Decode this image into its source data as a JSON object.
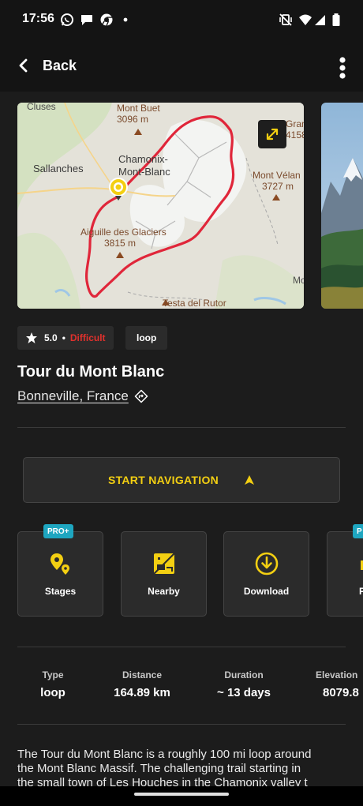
{
  "status_bar": {
    "time": "17:56",
    "left_icons": [
      "whatsapp-icon",
      "chat-bubble-icon",
      "chrome-icon",
      "notification-dot-icon"
    ],
    "right_icons": [
      "vibrate-off-icon",
      "wifi-icon",
      "signal-icon",
      "battery-icon"
    ]
  },
  "app_bar": {
    "back_label": "Back",
    "menu_icon": "more-vertical-icon"
  },
  "gallery": {
    "map_labels": {
      "cluses": "Cluses",
      "mont_buet": "Mont Buet",
      "mont_buet_elev": "3096 m",
      "sallanches": "Sallanches",
      "chamonix_1": "Chamonix-",
      "chamonix_2": "Mont-Blanc",
      "glaciers_1": "Aiguille des Glaciers",
      "glaciers_2": "3815 m",
      "grand": "Grand",
      "grand_elev": "4158",
      "velan_1": "Mont Vélan",
      "velan_2": "3727 m",
      "testa": "Testa del Rutor",
      "mo": "Mo"
    },
    "route_color": "#e0263a",
    "expand_icon": "expand-icon"
  },
  "badges": {
    "rating": "5.0",
    "difficulty": "Difficult",
    "type_chip": "loop"
  },
  "trail": {
    "title": "Tour du Mont Blanc",
    "location": "Bonneville, France"
  },
  "navigation": {
    "start_label": "START NAVIGATION"
  },
  "actions": [
    {
      "label": "Stages",
      "icon": "stages-pin-icon",
      "pro": "PRO+"
    },
    {
      "label": "Nearby",
      "icon": "nearby-icon"
    },
    {
      "label": "Download",
      "icon": "download-icon"
    },
    {
      "label": "P",
      "icon": "partial-icon",
      "pro": "P"
    }
  ],
  "stats": [
    {
      "label": "Type",
      "value": "loop"
    },
    {
      "label": "Distance",
      "value": "164.89 km"
    },
    {
      "label": "Duration",
      "value": "~ 13 days"
    },
    {
      "label": "Elevation",
      "value": "8079.8"
    }
  ],
  "description": {
    "line1": "The Tour du Mont Blanc is a roughly 100 mi loop around",
    "line2": "the Mont Blanc Massif. The challenging trail starting in",
    "line3": "the small town of Les Houches in the Chamonix valley t"
  },
  "colors": {
    "accent": "#f3cf12",
    "difficulty": "#e0312d",
    "pro_badge": "#1ea6c0",
    "background": "#1c1c1c",
    "card": "#2b2b2b"
  }
}
